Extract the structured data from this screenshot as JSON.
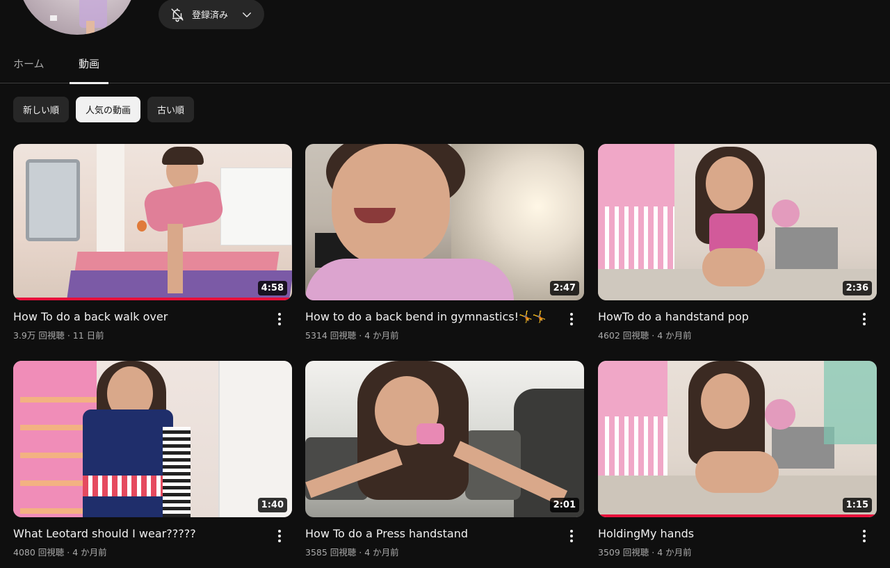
{
  "header": {
    "subscribe_label": "登録済み",
    "bell_icon": "bell-off-icon",
    "chevron_icon": "chevron-down-icon"
  },
  "tabs": [
    {
      "label": "ホーム",
      "active": false
    },
    {
      "label": "動画",
      "active": true
    }
  ],
  "sort_chips": [
    {
      "label": "新しい順",
      "active": false
    },
    {
      "label": "人気の動画",
      "active": true
    },
    {
      "label": "古い順",
      "active": false
    }
  ],
  "videos": [
    {
      "title": "How To do a back walk over",
      "meta": "3.9万 回視聴 · 11 日前",
      "duration": "4:58",
      "watched": true
    },
    {
      "title": "How to do a back bend in gymnastics!🤸🤸",
      "meta": "5314 回視聴 · 4 か月前",
      "duration": "2:47",
      "watched": false
    },
    {
      "title": "HowTo do a handstand pop",
      "meta": "4602 回視聴 · 4 か月前",
      "duration": "2:36",
      "watched": false
    },
    {
      "title": "What Leotard should I wear?????",
      "meta": "4080 回視聴 · 4 か月前",
      "duration": "1:40",
      "watched": false
    },
    {
      "title": "How To do a Press handstand",
      "meta": "3585 回視聴 · 4 か月前",
      "duration": "2:01",
      "watched": false
    },
    {
      "title": "HoldingMy hands",
      "meta": "3509 回視聴 · 4 か月前",
      "duration": "1:15",
      "watched": true
    }
  ],
  "colors": {
    "background": "#0f0f0f",
    "chip": "#272727",
    "chip_active": "#f1f1f1",
    "progress": "#e8103b",
    "secondary_text": "#aaaaaa"
  }
}
